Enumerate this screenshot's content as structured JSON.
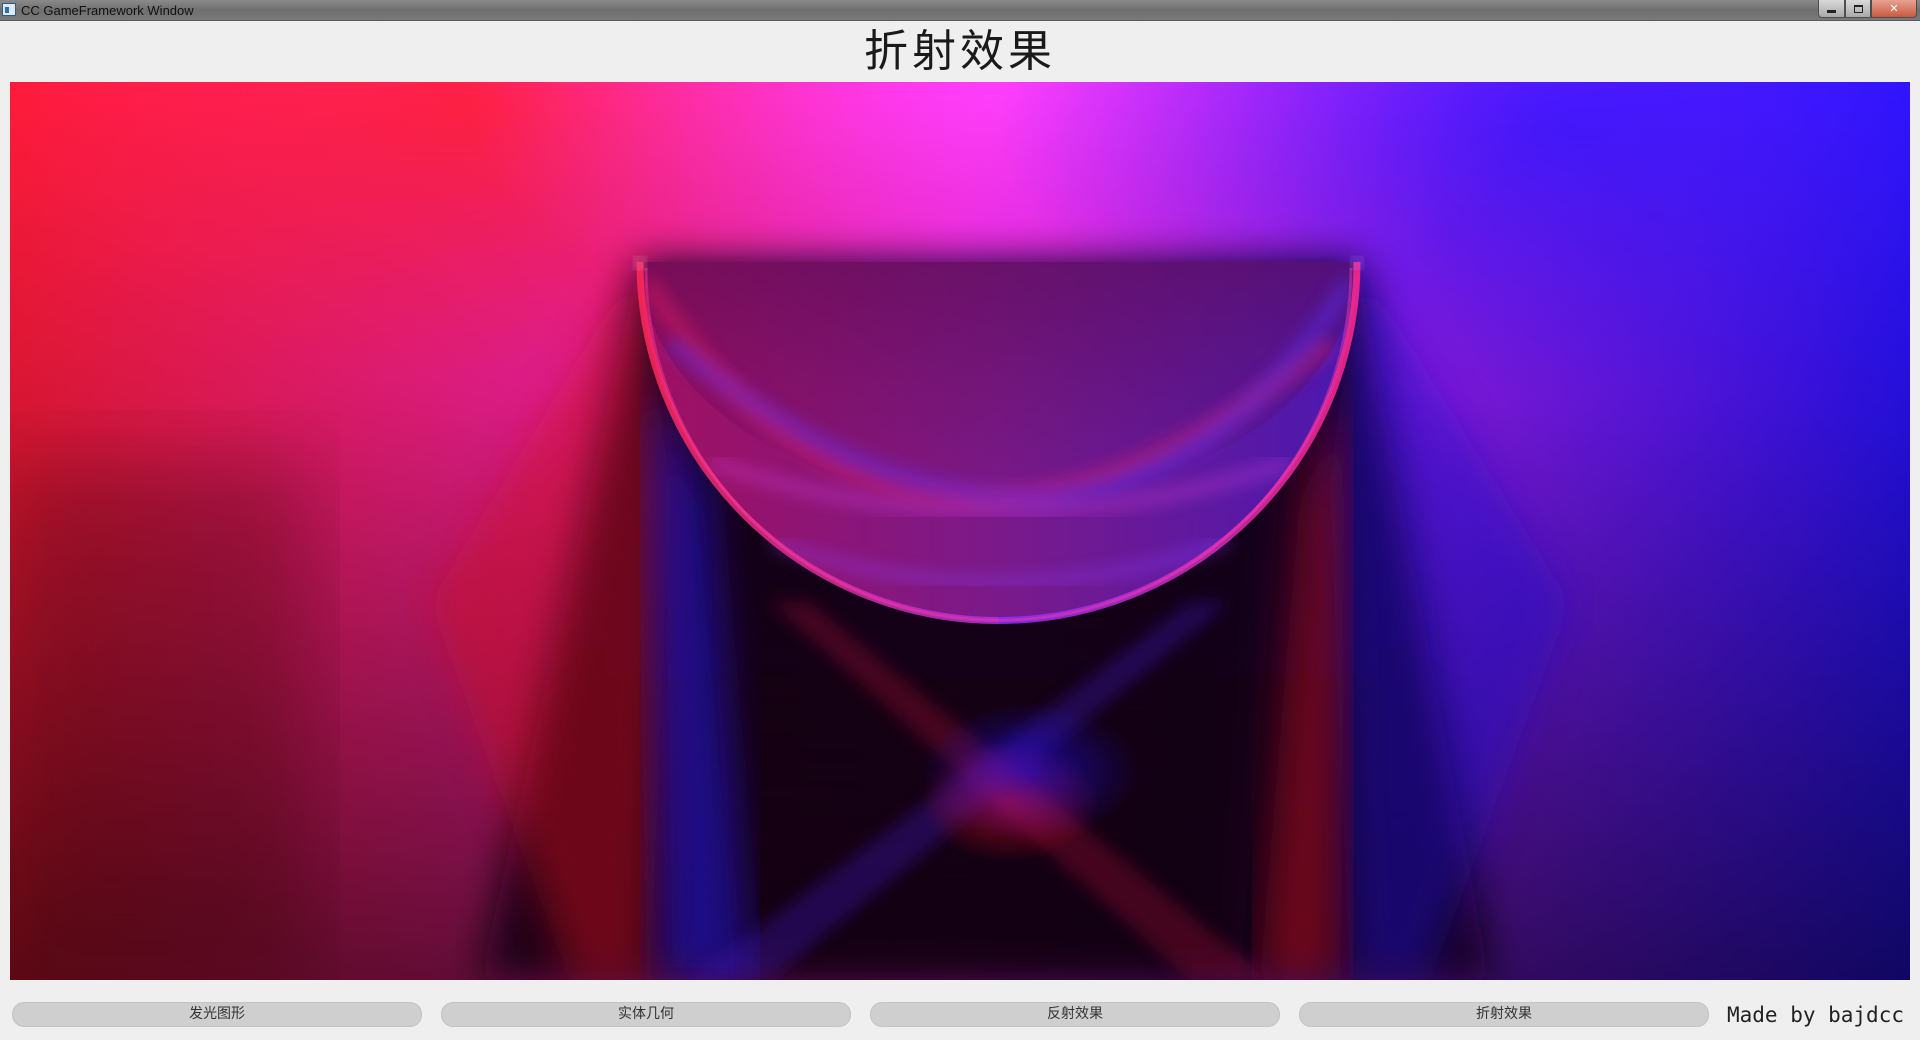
{
  "window": {
    "title": "CC GameFramework Window",
    "controls": {
      "minimize": "minimize",
      "maximize": "maximize",
      "close": "✕"
    }
  },
  "scene": {
    "title": "折射效果"
  },
  "canvas": {
    "icon": "rendered-refraction-scene",
    "colors": {
      "left_light": "#ff1a3a",
      "center_light": "#ff28f0",
      "right_light": "#2a12ff",
      "dark": "#050010"
    }
  },
  "buttons": [
    {
      "label": "发光图形"
    },
    {
      "label": "实体几何"
    },
    {
      "label": "反射效果"
    },
    {
      "label": "折射效果"
    }
  ],
  "credit": "Made by bajdcc"
}
